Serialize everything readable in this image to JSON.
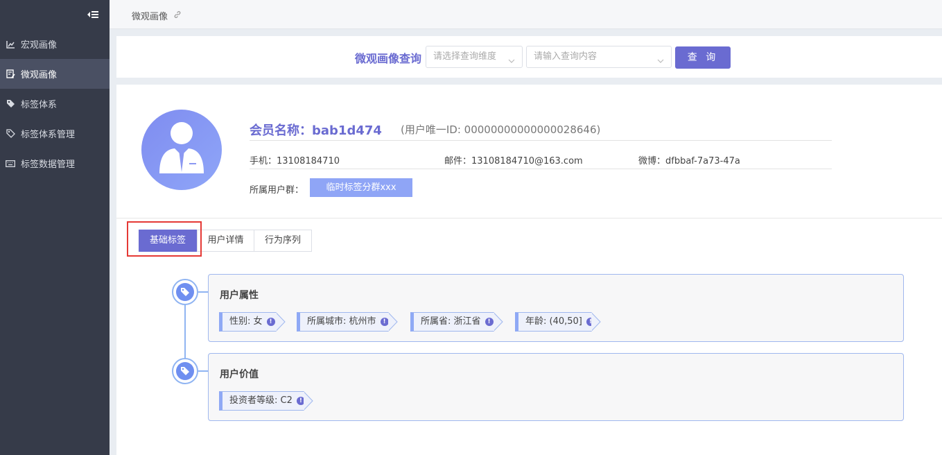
{
  "sidebar": {
    "items": [
      {
        "label": "宏观画像",
        "icon": "line-chart-icon"
      },
      {
        "label": "微观画像",
        "icon": "user-edit-icon"
      },
      {
        "label": "标签体系",
        "icon": "tag-icon"
      },
      {
        "label": "标签体系管理",
        "icon": "tag-settings-icon"
      },
      {
        "label": "标签数据管理",
        "icon": "keyboard-icon"
      }
    ]
  },
  "breadcrumb": {
    "label": "微观画像"
  },
  "search": {
    "title": "微观画像查询",
    "dimension_placeholder": "请选择查询维度",
    "content_placeholder": "请输入查询内容",
    "button_label": "查 询"
  },
  "profile": {
    "name": "会员名称：bab1d474",
    "user_id": "(用户唯一ID: 00000000000000028646)",
    "phone": "手机：13108184710",
    "email": "邮件：13108184710@163.com",
    "weibo": "微博：dfbbaf-7a73-47a",
    "group_label": "所属用户群：",
    "group_tag": "临时标签分群xxx"
  },
  "tabs": [
    {
      "label": "基础标签",
      "active": true
    },
    {
      "label": "用户详情",
      "active": false
    },
    {
      "label": "行为序列",
      "active": false
    }
  ],
  "sections": [
    {
      "title": "用户属性",
      "tags": [
        "性别: 女",
        "所属城市: 杭州市",
        "所属省: 浙江省",
        "年龄: (40,50]"
      ]
    },
    {
      "title": "用户价值",
      "tags": [
        "投资者等级: C2"
      ]
    }
  ],
  "colors": {
    "accent": "#6a6bd1",
    "sidebar_bg": "#363b49",
    "highlight": "#e53935"
  }
}
